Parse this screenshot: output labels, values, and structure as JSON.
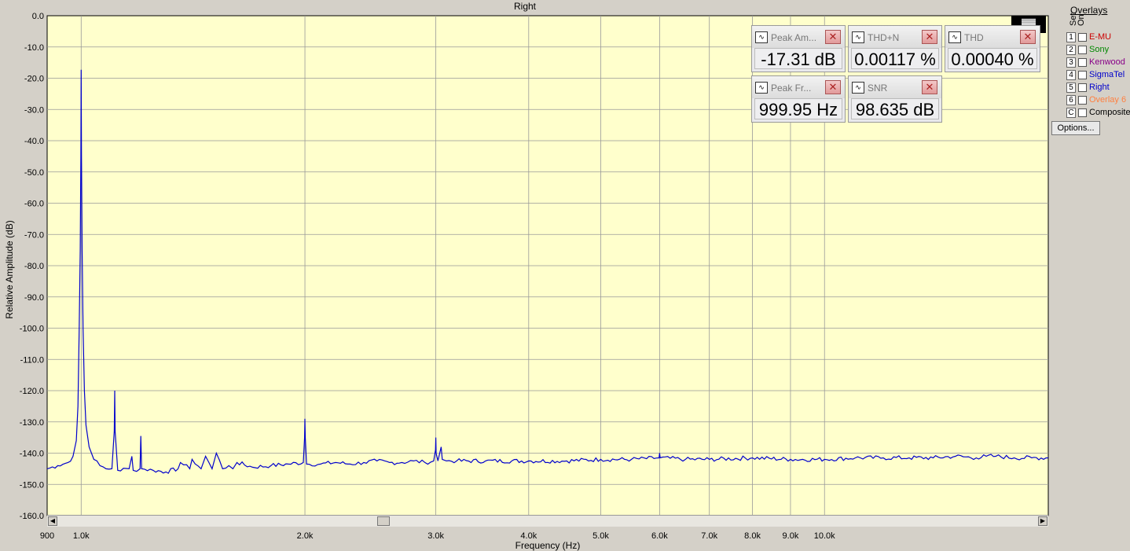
{
  "chart_data": {
    "type": "line",
    "title": "Right",
    "xlabel": "Frequency (Hz)",
    "ylabel": "Relative Amplitude (dB)",
    "x_scale": "log",
    "xlim": [
      900,
      20000
    ],
    "ylim": [
      -160,
      0
    ],
    "grid": true,
    "yticks": [
      0,
      -10,
      -20,
      -30,
      -40,
      -50,
      -60,
      -70,
      -80,
      -90,
      -100,
      -110,
      -120,
      -130,
      -140,
      -150,
      -160
    ],
    "ytick_labels": [
      "0.0",
      "-10.0",
      "-20.0",
      "-30.0",
      "-40.0",
      "-50.0",
      "-60.0",
      "-70.0",
      "-80.0",
      "-90.0",
      "-100.0",
      "-110.0",
      "-120.0",
      "-130.0",
      "-140.0",
      "-150.0",
      "-160.0"
    ],
    "xticks": [
      900,
      1000,
      2000,
      3000,
      4000,
      5000,
      6000,
      7000,
      8000,
      9000,
      10000
    ],
    "xtick_labels": [
      "900",
      "1.0k",
      "2.0k",
      "3.0k",
      "4.0k",
      "5.0k",
      "6.0k",
      "7.0k",
      "8.0k",
      "9.0k",
      "10.0k"
    ],
    "series": [
      {
        "name": "Right",
        "color": "#0000cc",
        "x": [
          900,
          930,
          960,
          975,
          985,
          990,
          994,
          997,
          999,
          1000,
          1001,
          1003,
          1006,
          1010,
          1015,
          1025,
          1040,
          1060,
          1080,
          1100,
          1108,
          1109.5,
          1111,
          1120,
          1160,
          1170,
          1175,
          1200,
          1203,
          1206,
          1250,
          1300,
          1350,
          1360,
          1400,
          1410,
          1450,
          1470,
          1500,
          1520,
          1550,
          1580,
          1600,
          1620,
          1700,
          1800,
          1900,
          1990,
          1998,
          2000,
          2002,
          2010,
          2100,
          2200,
          2300,
          2400,
          2500,
          2600,
          2700,
          2800,
          2900,
          2980,
          2997,
          3000,
          3003,
          3020,
          3050,
          3060,
          3100,
          3200,
          3500,
          4000,
          4500,
          5000,
          5500,
          5990,
          6000,
          6010,
          6500,
          7000,
          8000,
          9000,
          10000,
          11000,
          12000,
          13000,
          14000,
          15000,
          16000,
          16500,
          17000,
          18000,
          19000,
          20000
        ],
        "y": [
          -145,
          -144,
          -143,
          -141,
          -136,
          -125,
          -100,
          -75,
          -45,
          -17.31,
          -45,
          -75,
          -100,
          -120,
          -131,
          -138,
          -142,
          -144,
          -145,
          -145,
          -133,
          -120,
          -133,
          -145.5,
          -145,
          -141,
          -145.5,
          -145,
          -134.5,
          -145,
          -145.5,
          -146,
          -145,
          -143,
          -145,
          -142,
          -145,
          -141,
          -145,
          -140,
          -145,
          -144,
          -145,
          -143,
          -144.5,
          -144,
          -143.5,
          -143,
          -135,
          -129,
          -135,
          -143.5,
          -143.5,
          -143,
          -143.5,
          -143,
          -142.5,
          -143,
          -143,
          -142.5,
          -143,
          -142.5,
          -139,
          -135,
          -140,
          -142.5,
          -138,
          -142,
          -142.5,
          -142.5,
          -142.5,
          -142.5,
          -142.5,
          -142,
          -142,
          -141.5,
          -140,
          -141.5,
          -142,
          -142,
          -141.5,
          -142,
          -142,
          -141.5,
          -141.5,
          -141.5,
          -141.5,
          -141,
          -141.5,
          -141,
          -141,
          -141.5,
          -141.5,
          -141.5
        ]
      }
    ]
  },
  "meters": [
    {
      "name": "Peak Am...",
      "value": "-17.31 dB"
    },
    {
      "name": "THD+N",
      "value": "0.00117 %"
    },
    {
      "name": "THD",
      "value": "0.00040 %"
    },
    {
      "name": "Peak Fr...",
      "value": "999.95 Hz"
    },
    {
      "name": "SNR",
      "value": "98.635 dB"
    }
  ],
  "overlays": {
    "title": "Overlays",
    "set_label": "Set",
    "on_label": "On",
    "items": [
      {
        "num": "1",
        "name": "E-MU",
        "color": "#cc0000"
      },
      {
        "num": "2",
        "name": "Sony",
        "color": "#008800"
      },
      {
        "num": "3",
        "name": "Kenwood",
        "color": "#880088"
      },
      {
        "num": "4",
        "name": "SigmaTel",
        "color": "#0000cc"
      },
      {
        "num": "5",
        "name": "Right",
        "color": "#0000cc"
      },
      {
        "num": "6",
        "name": "Overlay 6",
        "color": "#ff8040"
      },
      {
        "num": "C",
        "name": "Composite",
        "color": "#000000"
      }
    ],
    "options_label": "Options..."
  },
  "colors": {
    "plot_bg": "#ffffcc",
    "grid": "#999999",
    "trace": "#0000cc"
  }
}
